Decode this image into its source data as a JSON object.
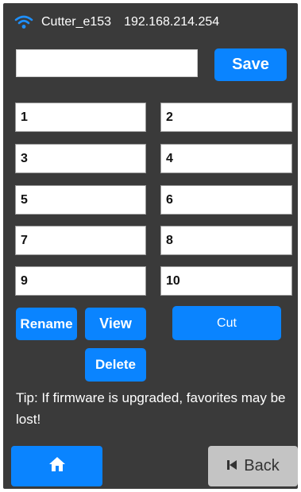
{
  "status": {
    "wifi_icon": "wifi-icon",
    "device_name": "Cutter_e153",
    "ip": "192.168.214.254"
  },
  "name_field": {
    "value": "",
    "placeholder": ""
  },
  "save_label": "Save",
  "slots": [
    "1",
    "2",
    "3",
    "4",
    "5",
    "6",
    "7",
    "8",
    "9",
    "10"
  ],
  "actions": {
    "rename": "Rename",
    "view": "View",
    "cut": "Cut",
    "delete": "Delete"
  },
  "tip": "Tip: If firmware is upgraded, favorites may be lost!",
  "nav": {
    "home_icon": "home-icon",
    "back_icon": "skip-back-icon",
    "back_label": "Back"
  },
  "colors": {
    "accent": "#0a84ff",
    "background": "#3a3a3a",
    "back_button": "#c4c4c4"
  }
}
